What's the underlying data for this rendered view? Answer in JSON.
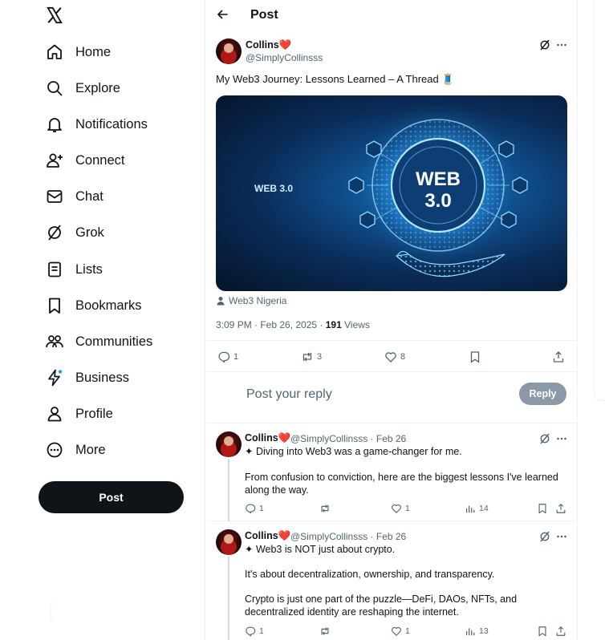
{
  "sidebar": {
    "items": [
      {
        "label": "Home",
        "icon": "home-icon"
      },
      {
        "label": "Explore",
        "icon": "search-icon"
      },
      {
        "label": "Notifications",
        "icon": "bell-icon"
      },
      {
        "label": "Connect",
        "icon": "person-add-icon"
      },
      {
        "label": "Chat",
        "icon": "envelope-icon"
      },
      {
        "label": "Grok",
        "icon": "grok-icon"
      },
      {
        "label": "Lists",
        "icon": "list-icon"
      },
      {
        "label": "Bookmarks",
        "icon": "bookmark-icon"
      },
      {
        "label": "Communities",
        "icon": "communities-icon"
      },
      {
        "label": "Business",
        "icon": "lightning-icon"
      },
      {
        "label": "Profile",
        "icon": "person-icon"
      },
      {
        "label": "More",
        "icon": "more-circle-icon"
      }
    ],
    "post_label": "Post"
  },
  "header": {
    "title": "Post"
  },
  "tweet": {
    "author": "Collins",
    "author_emoji": "❤️",
    "handle": "@SimplyCollinsss",
    "text": "My Web3 Journey: Lessons Learned – A Thread 🧵",
    "image_text_left": "WEB 3.0",
    "image_text_center": "WEB",
    "image_text_center2": "3.0",
    "location": "Web3 Nigeria",
    "time": "3:09 PM · Feb 26, 2025 · ",
    "views_count": "191",
    "views_label": " Views",
    "replies": "1",
    "reposts": "3",
    "likes": "8"
  },
  "reply_box": {
    "placeholder": "Post your reply",
    "button": "Reply"
  },
  "replies": [
    {
      "author": "Collins",
      "author_emoji": "❤️",
      "handle_date": "@SimplyCollinsss · Feb 26",
      "line1": "✦ Diving into Web3 was a game-changer for me.",
      "line2": "From confusion to conviction, here are the biggest lessons I've learned along the way.",
      "replies": "1",
      "likes": "1",
      "views": "14"
    },
    {
      "author": "Collins",
      "author_emoji": "❤️",
      "handle_date": "@SimplyCollinsss · Feb 26",
      "line1": "✦ Web3 is NOT just about crypto.",
      "line2": "It's about decentralization, ownership, and transparency.",
      "line3": "Crypto is just one part of the puzzle—DeFi, DAOs, NFTs, and decentralized identity are reshaping the internet.",
      "replies": "1",
      "likes": "1",
      "views": "13"
    }
  ]
}
